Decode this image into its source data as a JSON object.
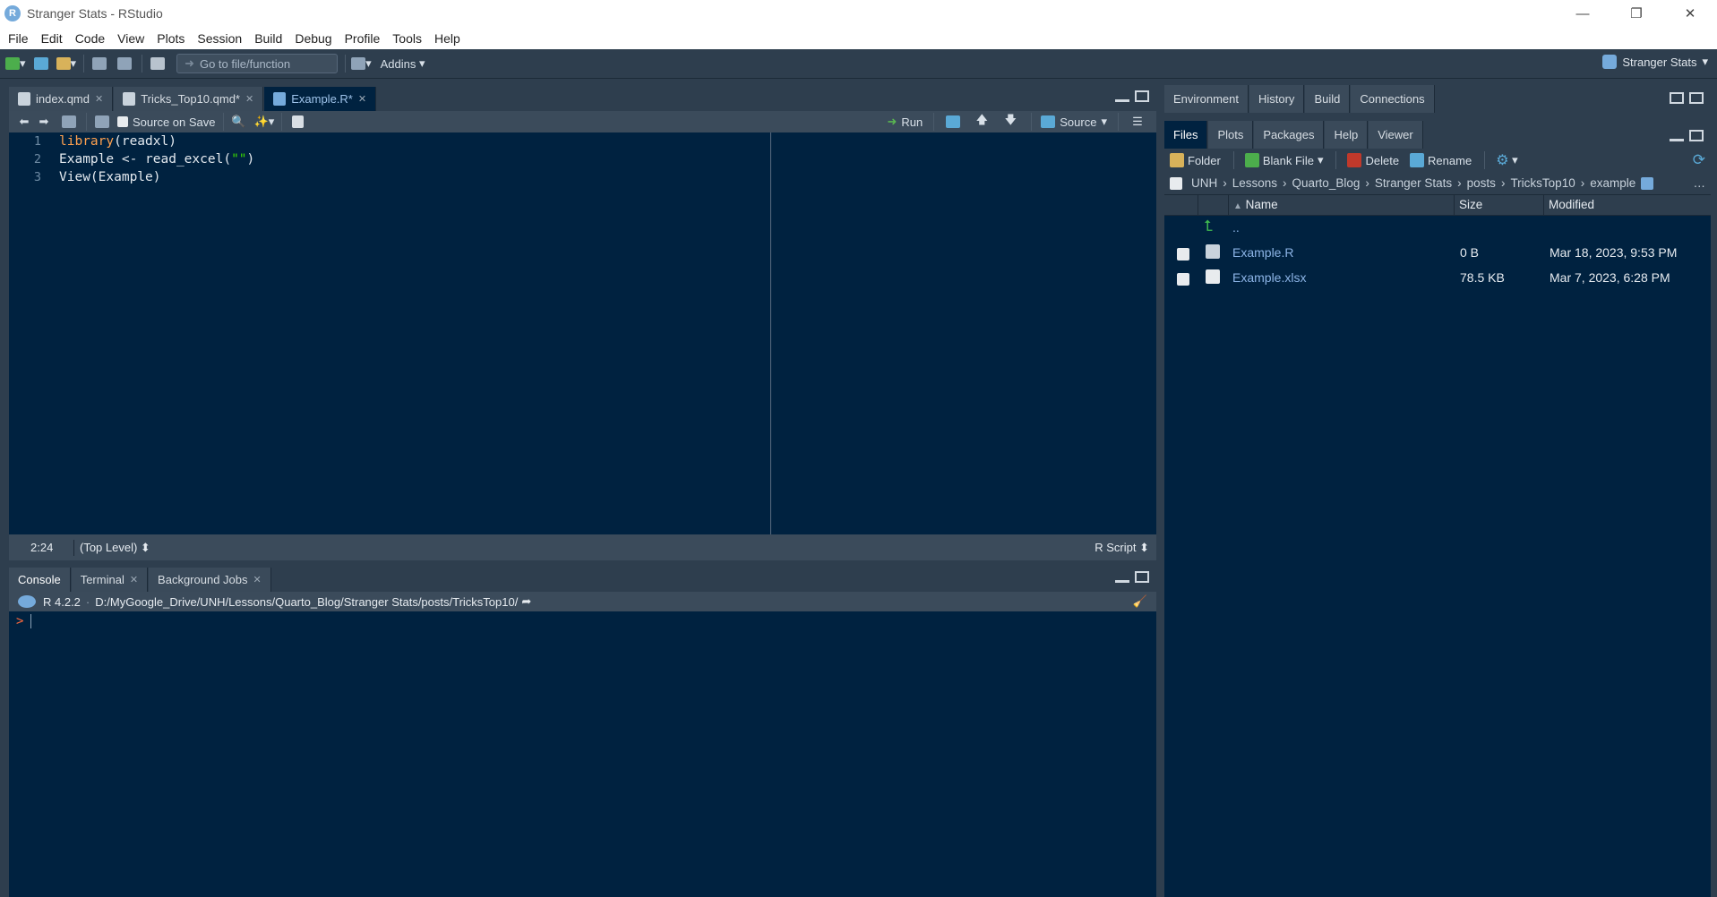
{
  "window": {
    "title": "Stranger Stats - RStudio",
    "app_icon_letter": "R",
    "controls": [
      "—",
      "❐",
      "✕"
    ]
  },
  "menu": [
    "File",
    "Edit",
    "Code",
    "View",
    "Plots",
    "Session",
    "Build",
    "Debug",
    "Profile",
    "Tools",
    "Help"
  ],
  "toolbar": {
    "goto_placeholder": "Go to file/function",
    "addins_label": "Addins",
    "project_name": "Stranger Stats"
  },
  "source": {
    "tabs": [
      {
        "label": "index.qmd",
        "active": false
      },
      {
        "label": "Tricks_Top10.qmd*",
        "active": false
      },
      {
        "label": "Example.R*",
        "active": true
      }
    ],
    "source_on_save": "Source on Save",
    "run_label": "Run",
    "source_label": "Source",
    "line_numbers": [
      "1",
      "2",
      "3"
    ],
    "code": {
      "line1_fn": "library",
      "line1_rest": "(readxl)",
      "line2_pre": "Example <- read_excel(",
      "line2_str": "\"\"",
      "line2_post": ")",
      "line3": "View(Example)"
    },
    "status": {
      "position": "2:24",
      "scope": "(Top Level)",
      "file_type": "R Script"
    }
  },
  "console": {
    "tabs": [
      {
        "label": "Console",
        "active": true
      },
      {
        "label": "Terminal",
        "active": false
      },
      {
        "label": "Background Jobs",
        "active": false
      }
    ],
    "r_version": "R 4.2.2",
    "working_dir": "D:/MyGoogle_Drive/UNH/Lessons/Quarto_Blog/Stranger Stats/posts/TricksTop10/",
    "prompt": ">"
  },
  "env_pane": {
    "tabs": [
      "Environment",
      "History",
      "Build",
      "Connections"
    ]
  },
  "files_pane": {
    "tabs": [
      {
        "label": "Files",
        "active": true
      },
      {
        "label": "Plots",
        "active": false
      },
      {
        "label": "Packages",
        "active": false
      },
      {
        "label": "Help",
        "active": false
      },
      {
        "label": "Viewer",
        "active": false
      }
    ],
    "toolbar": {
      "folder": "Folder",
      "blank_file": "Blank File",
      "delete": "Delete",
      "rename": "Rename"
    },
    "breadcrumb": [
      "UNH",
      "Lessons",
      "Quarto_Blog",
      "Stranger Stats",
      "posts",
      "TricksTop10",
      "example"
    ],
    "columns": {
      "name": "Name",
      "size": "Size",
      "modified": "Modified"
    },
    "parent_label": "..",
    "files": [
      {
        "name": "Example.R",
        "size": "0 B",
        "modified": "Mar 18, 2023, 9:53 PM"
      },
      {
        "name": "Example.xlsx",
        "size": "78.5 KB",
        "modified": "Mar 7, 2023, 6:28 PM"
      }
    ]
  }
}
